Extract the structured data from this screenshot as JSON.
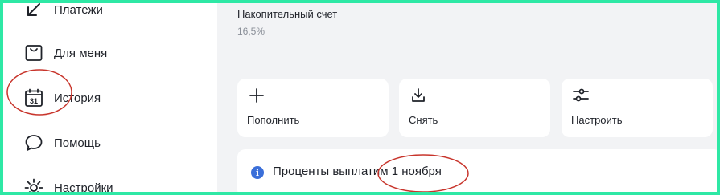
{
  "sidebar": {
    "items": [
      {
        "label": "Платежи",
        "icon": "arrow-back-icon"
      },
      {
        "label": "Для меня",
        "icon": "shopping-bag-icon"
      },
      {
        "label": "История",
        "icon": "calendar-icon",
        "icon_text": "31"
      },
      {
        "label": "Помощь",
        "icon": "chat-bubble-icon"
      },
      {
        "label": "Настройки",
        "icon": "gear-icon"
      }
    ]
  },
  "account": {
    "title": "Накопительный счет",
    "rate": "16,5%"
  },
  "actions": [
    {
      "label": "Пополнить",
      "icon": "plus-icon"
    },
    {
      "label": "Снять",
      "icon": "download-icon"
    },
    {
      "label": "Настроить",
      "icon": "sliders-icon"
    }
  ],
  "info": {
    "text": "Проценты выплатим 1 ноября",
    "icon": "info-icon"
  },
  "colors": {
    "border": "#2ee8a5",
    "annotation": "#c8352c",
    "info_icon": "#3b6fd9",
    "background": "#f2f3f5"
  }
}
